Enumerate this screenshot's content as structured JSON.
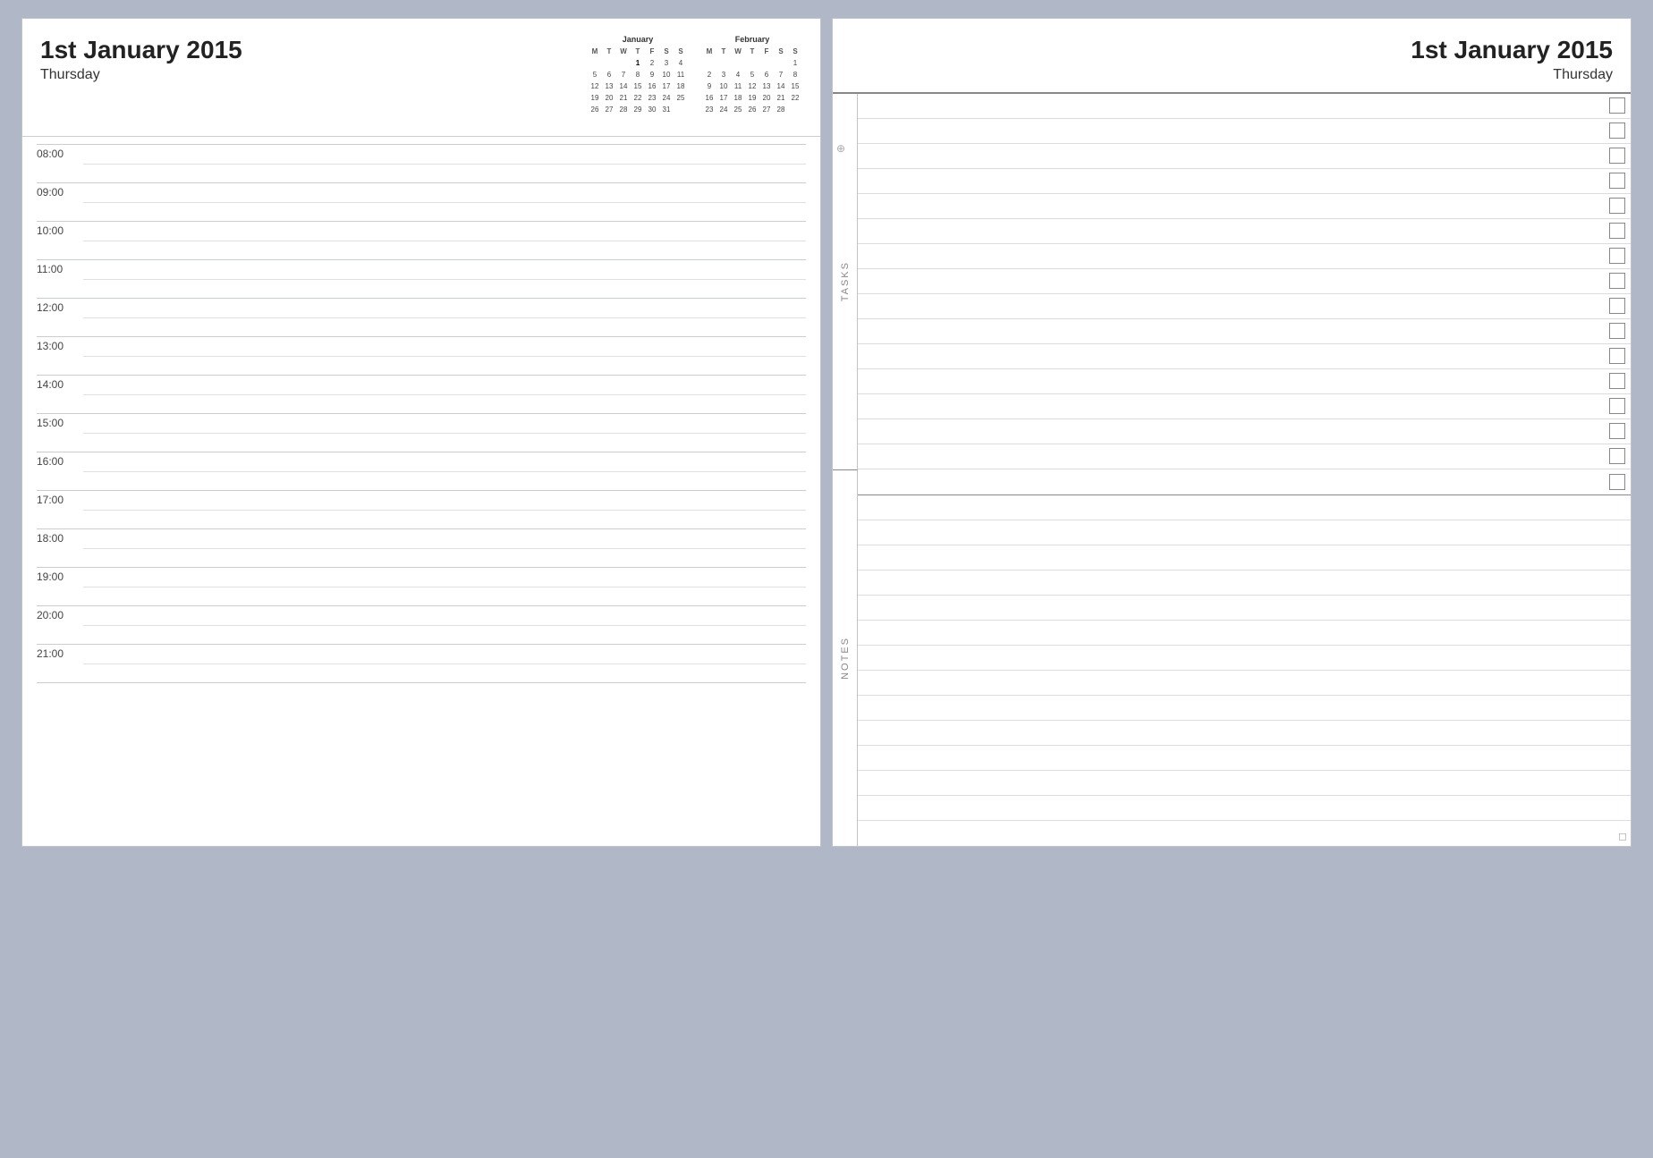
{
  "left": {
    "header": {
      "main_date": "1st January 2015",
      "day_name": "Thursday"
    },
    "january": {
      "title": "January",
      "days_header": [
        "M",
        "T",
        "W",
        "T",
        "F",
        "S",
        "S"
      ],
      "weeks": [
        [
          "",
          "",
          "",
          "1",
          "2",
          "3",
          "4"
        ],
        [
          "5",
          "6",
          "7",
          "8",
          "9",
          "10",
          "11"
        ],
        [
          "12",
          "13",
          "14",
          "15",
          "16",
          "17",
          "18"
        ],
        [
          "19",
          "20",
          "21",
          "22",
          "23",
          "24",
          "25"
        ],
        [
          "26",
          "27",
          "28",
          "29",
          "30",
          "31",
          ""
        ],
        [
          "",
          "",
          "",
          "",
          "",
          "",
          ""
        ]
      ]
    },
    "february": {
      "title": "February",
      "days_header": [
        "M",
        "T",
        "W",
        "T",
        "F",
        "S",
        "S"
      ],
      "weeks": [
        [
          "",
          "",
          "",
          "",
          "",
          "",
          "1"
        ],
        [
          "2",
          "3",
          "4",
          "5",
          "6",
          "7",
          "8"
        ],
        [
          "9",
          "10",
          "11",
          "12",
          "13",
          "14",
          "15"
        ],
        [
          "16",
          "17",
          "18",
          "19",
          "20",
          "21",
          "22"
        ],
        [
          "23",
          "24",
          "25",
          "26",
          "27",
          "28",
          ""
        ],
        [
          "",
          "",
          "",
          "",
          "",
          "",
          ""
        ]
      ]
    },
    "schedule": {
      "times": [
        "08:00",
        "09:00",
        "10:00",
        "11:00",
        "12:00",
        "13:00",
        "14:00",
        "15:00",
        "16:00",
        "17:00",
        "18:00",
        "19:00",
        "20:00",
        "21:00"
      ]
    }
  },
  "right": {
    "header": {
      "main_date": "1st January 2015",
      "day_name": "Thursday"
    },
    "tasks_label": "TASKS",
    "notes_label": "NOTES",
    "task_count": 16,
    "note_count": 14
  }
}
